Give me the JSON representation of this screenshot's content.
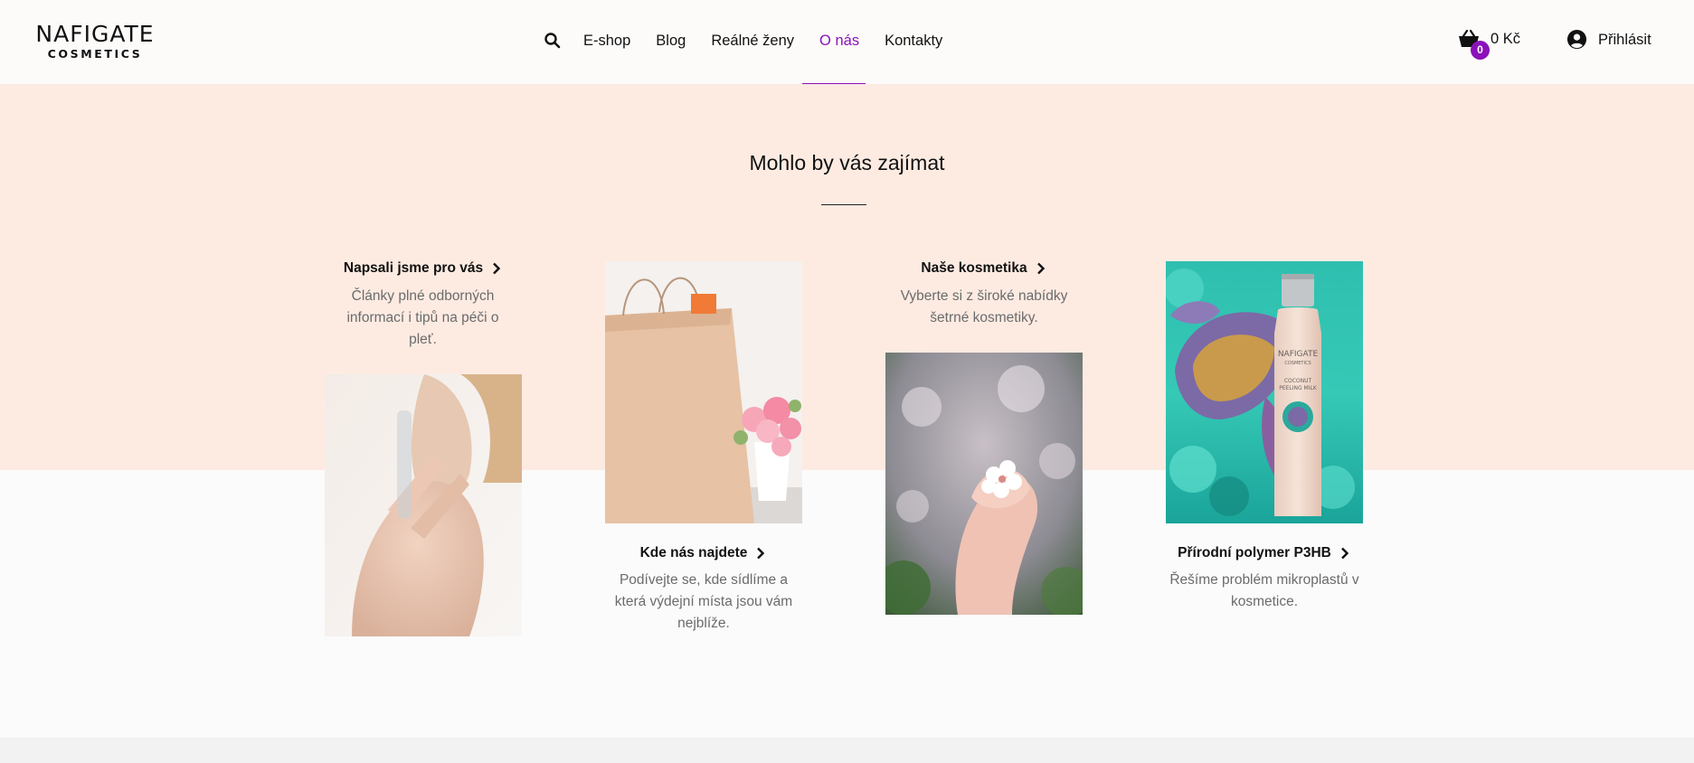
{
  "header": {
    "logo_main": "NAFIGATE",
    "logo_sub": "COSMETICS",
    "nav": [
      {
        "label": "E-shop"
      },
      {
        "label": "Blog"
      },
      {
        "label": "Reálné ženy"
      },
      {
        "label": "O nás",
        "active": true
      },
      {
        "label": "Kontakty"
      }
    ],
    "cart_count": "0",
    "cart_total": "0 Kč",
    "login_label": "Přihlásit"
  },
  "section": {
    "title": "Mohlo by vás zajímat"
  },
  "cards": [
    {
      "title": "Napsali jsme pro vás",
      "description": "Články plné odborných informací i tipů na péči o pleť."
    },
    {
      "title": "Kde nás najdete",
      "description": "Podívejte se, kde sídlíme a která výdejní místa jsou vám nejblíže."
    },
    {
      "title": "Naše kosmetika",
      "description": "Vyberte si z široké nabídky šetrné kosmetiky."
    },
    {
      "title": "Přírodní polymer P3HB",
      "description": "Řešíme problém mikroplastů v kosmetice."
    }
  ],
  "product_label": {
    "brand": "NAFIGATE",
    "brand_sub": "COSMETICS",
    "name_line1": "COCONUT",
    "name_line2": "PEELING MILK"
  },
  "colors": {
    "accent": "#8a12b8",
    "band": "#fdebe2",
    "background": "#fbfbfb"
  }
}
